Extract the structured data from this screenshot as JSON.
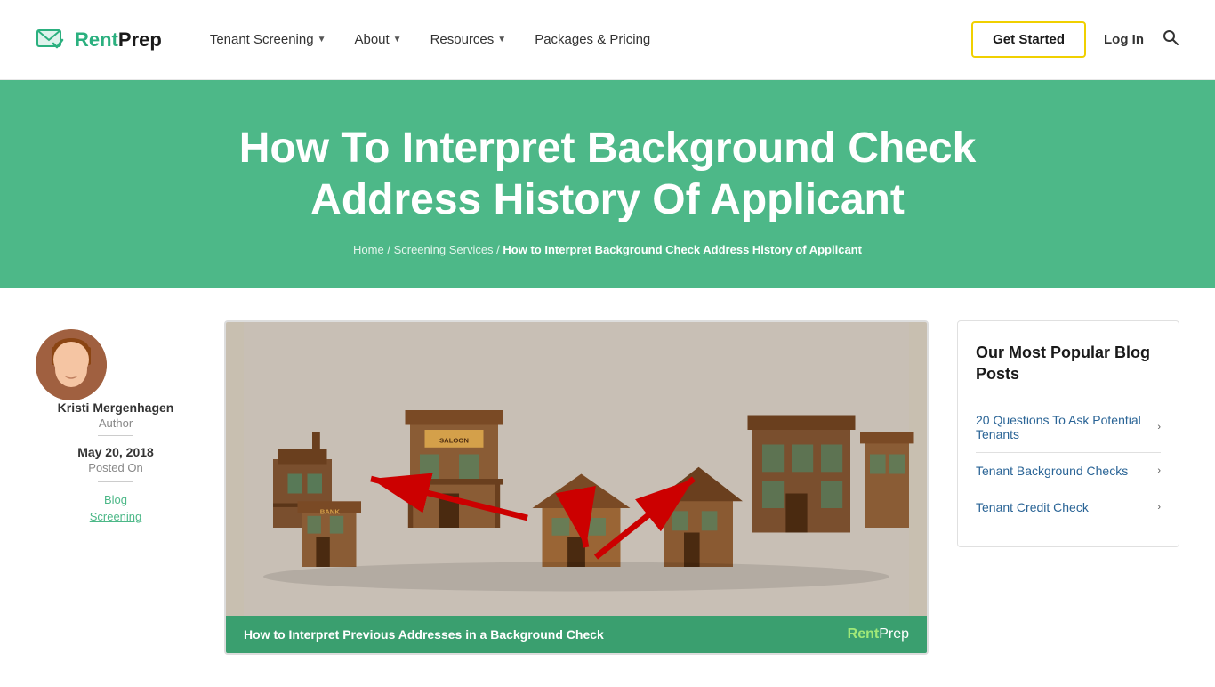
{
  "header": {
    "logo_text_rent": "Rent",
    "logo_text_prep": "Prep",
    "nav": [
      {
        "label": "Tenant Screening",
        "has_dropdown": true
      },
      {
        "label": "About",
        "has_dropdown": true
      },
      {
        "label": "Resources",
        "has_dropdown": true
      },
      {
        "label": "Packages & Pricing",
        "has_dropdown": false
      }
    ],
    "cta_label": "Get Started",
    "login_label": "Log In"
  },
  "hero": {
    "title": "How To Interpret Background Check Address History Of Applicant",
    "breadcrumb": {
      "home": "Home",
      "separator1": " / ",
      "section": "Screening Services",
      "separator2": " / ",
      "current": "How to Interpret Background Check Address History of Applicant"
    }
  },
  "author": {
    "name": "Kristi Mergenhagen",
    "role": "Author",
    "date": "May 20, 2018",
    "posted_on": "Posted On",
    "tags": [
      "Blog",
      "Screening"
    ]
  },
  "article": {
    "image_caption": "How to Interpret Previous Addresses in a Background Check",
    "caption_logo_rent": "Rent",
    "caption_logo_prep": "Prep"
  },
  "sidebar": {
    "widget_title": "Our Most Popular Blog Posts",
    "links": [
      {
        "label": "20 Questions To Ask Potential Tenants"
      },
      {
        "label": "Tenant Background Checks"
      },
      {
        "label": "Tenant Credit Check"
      }
    ]
  }
}
